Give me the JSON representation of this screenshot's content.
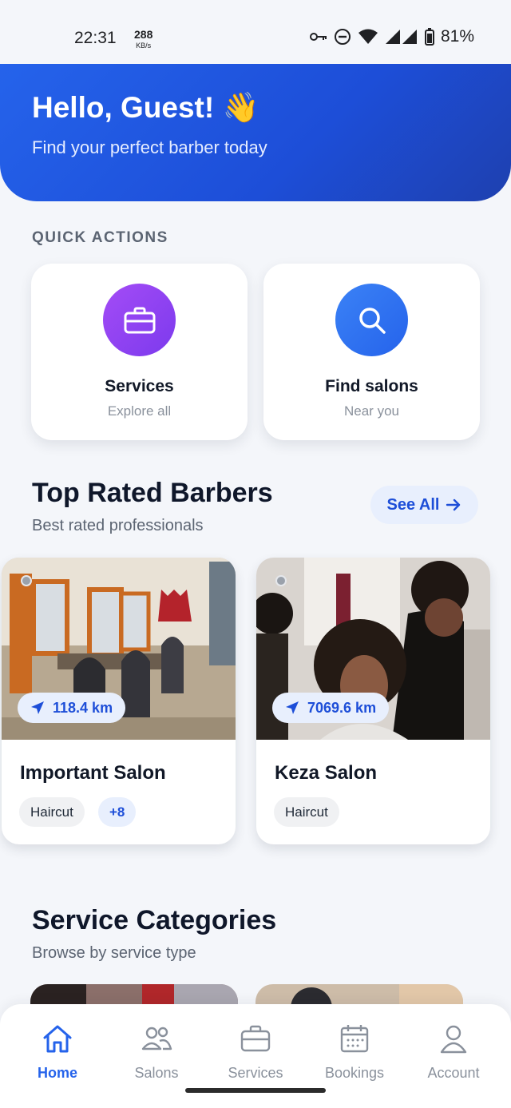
{
  "status_bar": {
    "time": "22:31",
    "net_speed": "288",
    "net_unit": "KB/s",
    "battery": "81%"
  },
  "header": {
    "greeting": "Hello, Guest! 👋",
    "subtitle": "Find your perfect barber today"
  },
  "quick_actions": {
    "label": "QUICK ACTIONS",
    "items": [
      {
        "title": "Services",
        "subtitle": "Explore all",
        "icon": "briefcase-icon",
        "color": "#8b3ff0"
      },
      {
        "title": "Find salons",
        "subtitle": "Near you",
        "icon": "search-icon",
        "color": "#2f6cf0"
      }
    ]
  },
  "top_rated": {
    "title": "Top Rated Barbers",
    "subtitle": "Best rated professionals",
    "see_all": "See All",
    "salons": [
      {
        "name": "Important Salon",
        "distance": "118.4 km",
        "tags": [
          "Haircut"
        ],
        "more": "+8"
      },
      {
        "name": "Keza Salon",
        "distance": "7069.6 km",
        "tags": [
          "Haircut"
        ],
        "more": ""
      }
    ]
  },
  "service_categories": {
    "title": "Service Categories",
    "subtitle": "Browse by service type"
  },
  "bottom_nav": {
    "items": [
      {
        "label": "Home",
        "icon": "home-icon",
        "active": true
      },
      {
        "label": "Salons",
        "icon": "users-icon",
        "active": false
      },
      {
        "label": "Services",
        "icon": "briefcase-icon",
        "active": false
      },
      {
        "label": "Bookings",
        "icon": "calendar-icon",
        "active": false
      },
      {
        "label": "Account",
        "icon": "user-icon",
        "active": false
      }
    ]
  },
  "colors": {
    "primary": "#2563eb",
    "header_gradient_end": "#1e40af",
    "background": "#f4f6fa"
  }
}
